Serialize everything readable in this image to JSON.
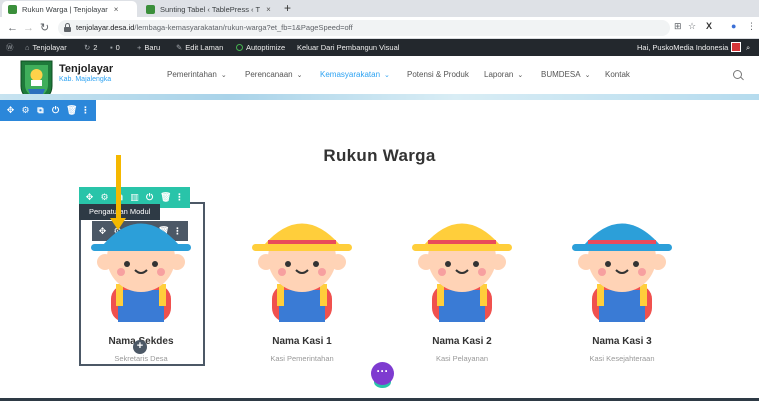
{
  "browser": {
    "tabs": [
      {
        "title": "Rukun Warga | Tenjolayar",
        "close": "×",
        "active": true
      },
      {
        "title": "Sunting Tabel ‹ TablePress ‹ T",
        "close": "×",
        "active": false
      }
    ],
    "new_tab": "+",
    "url_host": "tenjolayar.desa.id",
    "url_path": "/lembaga-kemasyarakatan/rukun-warga?et_fb=1&PageSpeed=off"
  },
  "admin_bar": {
    "site": "Tenjolayar",
    "updates": "2",
    "comments": "0",
    "new": "Baru",
    "edit": "Edit Laman",
    "autoptimize": "Autoptimize",
    "exit_builder": "Keluar Dari Pembangun Visual",
    "greeting": "Hai, PuskoMedia Indonesia"
  },
  "site": {
    "name": "Tenjolayar",
    "subtitle": "Kab. Majalengka",
    "menu": [
      {
        "label": "Pemerintahan",
        "dropdown": true
      },
      {
        "label": "Perencanaan",
        "dropdown": true
      },
      {
        "label": "Kemasyarakatan",
        "dropdown": true,
        "active": true
      },
      {
        "label": "Potensi & Produk",
        "dropdown": false
      },
      {
        "label": "Laporan",
        "dropdown": true
      },
      {
        "label": "BUMDESA",
        "dropdown": true
      },
      {
        "label": "Kontak",
        "dropdown": false
      }
    ]
  },
  "builder": {
    "tooltip": "Pengaturan Modul",
    "add_label": "+",
    "fab_label": "···"
  },
  "section": {
    "title": "Rukun Warga"
  },
  "members": [
    {
      "name": "Nama Sekdes",
      "role": "Sekretaris Desa",
      "hat": "#2c9fd9",
      "hat_band": "#2c9fd9"
    },
    {
      "name": "Nama Kasi 1",
      "role": "Kasi Pemerintahan",
      "hat": "#ffce3b",
      "hat_band": "#e94b5b"
    },
    {
      "name": "Nama Kasi 2",
      "role": "Kasi Pelayanan",
      "hat": "#ffce3b",
      "hat_band": "#e94b5b"
    },
    {
      "name": "Nama Kasi 3",
      "role": "Kasi Kesejahteraan",
      "hat": "#2c9fd9",
      "hat_band": "#e94b5b"
    }
  ],
  "colors": {
    "accent": "#2ea3f2",
    "divi_section": "#2b87da",
    "divi_row": "#29c4a9",
    "divi_module": "#4c5866",
    "highlight_arrow": "#f5b800",
    "fab": "#7e3bd0"
  }
}
